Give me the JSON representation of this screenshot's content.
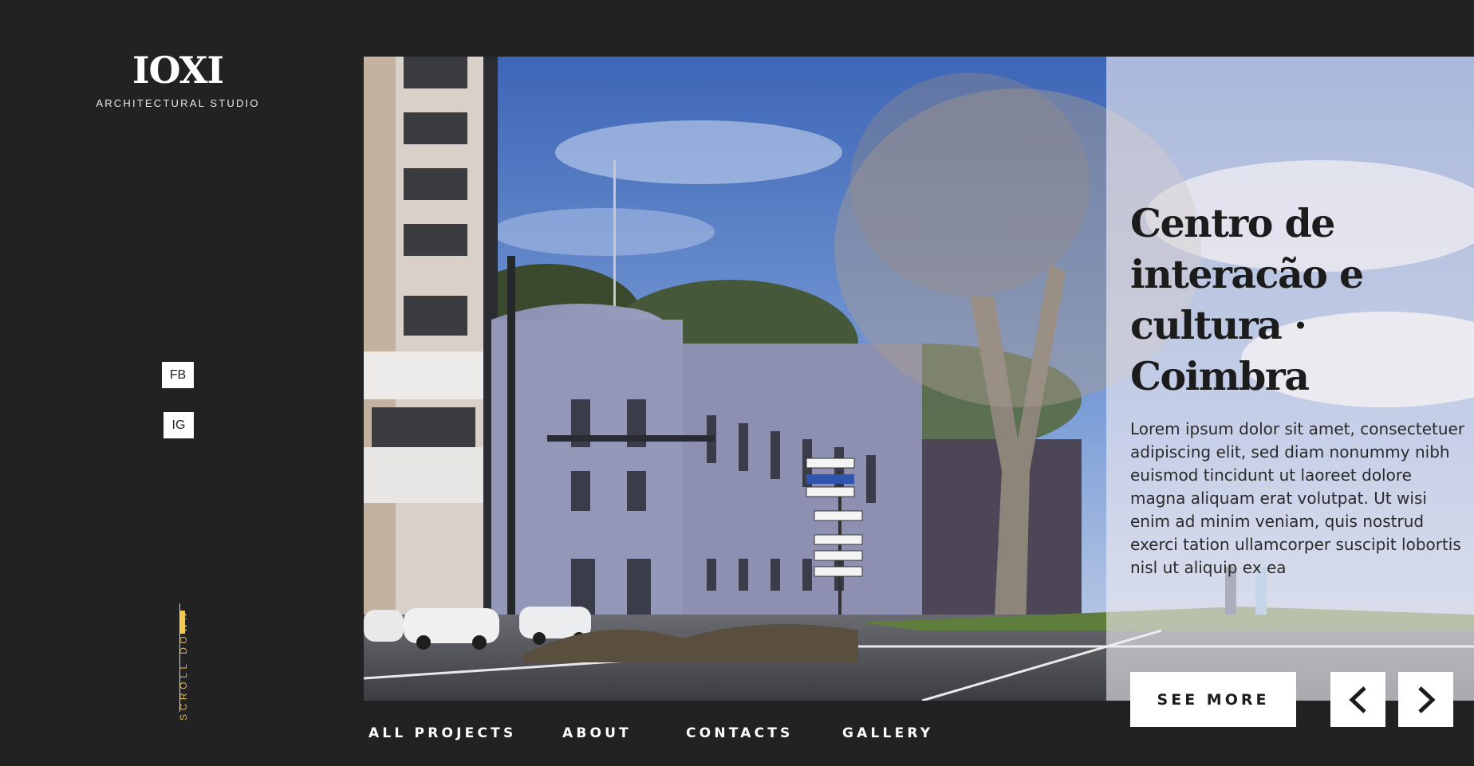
{
  "brand": {
    "logo": "IOXI",
    "subtitle": "ARCHITECTURAL STUDIO"
  },
  "social": {
    "facebook": "FB",
    "instagram": "IG"
  },
  "scroll": {
    "label": "SCROLL DOWN"
  },
  "hero": {
    "title": "Centro de interacão e cultura · Coimbra",
    "description": "Lorem ipsum dolor sit amet, consectetuer adipiscing elit, sed diam nonummy nibh euismod tincidunt ut laoreet dolore magna aliquam erat volutpat. Ut wisi enim ad minim veniam, quis nostrud exerci tation ullamcorper suscipit lobortis nisl ut aliquip ex ea",
    "see_more": "SEE MORE",
    "prev_icon": "chevron-left-icon",
    "next_icon": "chevron-right-icon"
  },
  "nav": {
    "items": [
      {
        "label": "ALL PROJECTS"
      },
      {
        "label": "ABOUT"
      },
      {
        "label": "CONTACTS"
      },
      {
        "label": "GALLERY"
      }
    ]
  },
  "colors": {
    "background": "#222223",
    "accent": "#e3b24c",
    "overlay": "#f0ecf0"
  }
}
